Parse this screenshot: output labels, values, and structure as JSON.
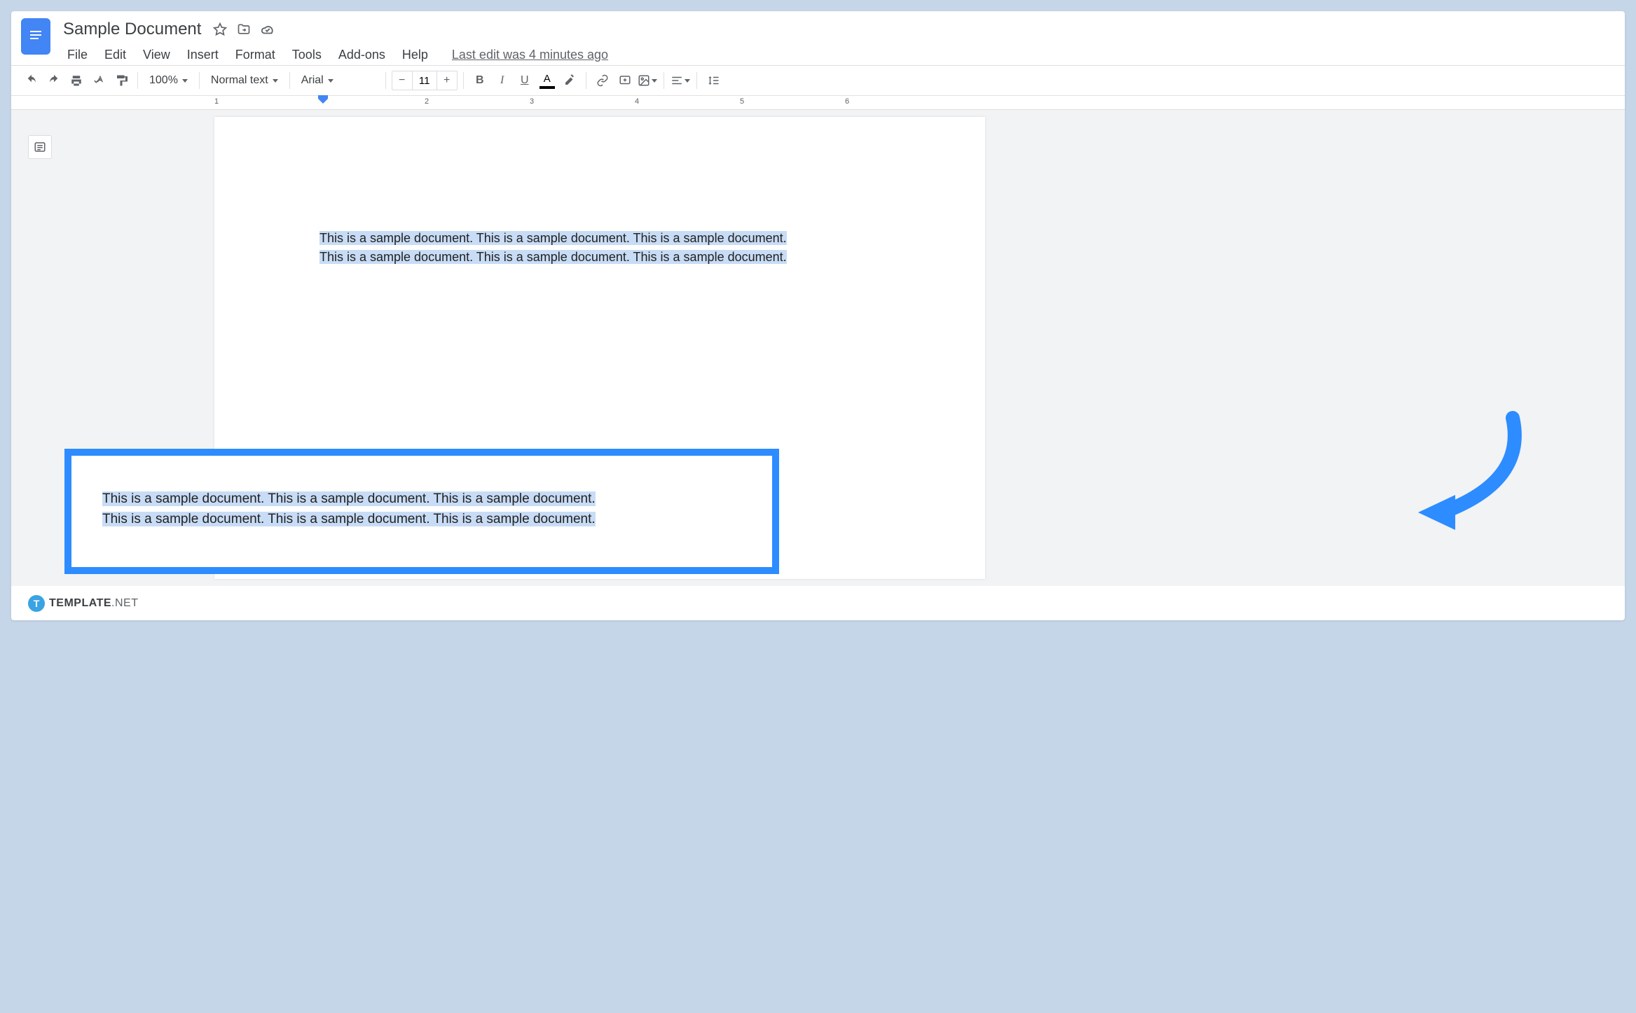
{
  "doc": {
    "title": "Sample Document",
    "last_edit": "Last edit was 4 minutes ago"
  },
  "menu": {
    "file": "File",
    "edit": "Edit",
    "view": "View",
    "insert": "Insert",
    "format": "Format",
    "tools": "Tools",
    "addons": "Add-ons",
    "help": "Help"
  },
  "toolbar": {
    "zoom": "100%",
    "style": "Normal text",
    "font": "Arial",
    "font_size": "11"
  },
  "ruler": {
    "marks": [
      "1",
      "2",
      "3",
      "4",
      "5",
      "6"
    ]
  },
  "document_body": {
    "line1": "This is a sample document. This is a sample document. This is a sample document.",
    "line2": "This is a sample document. This is a sample document. This is a sample document."
  },
  "callout": {
    "line1": "This is a sample document. This is a sample document. This is a sample document.",
    "line2": "This is a sample document. This is a sample document. This is a sample document."
  },
  "watermark": {
    "brand_bold": "TEMPLATE",
    "brand_light": ".NET",
    "icon_letter": "T"
  }
}
